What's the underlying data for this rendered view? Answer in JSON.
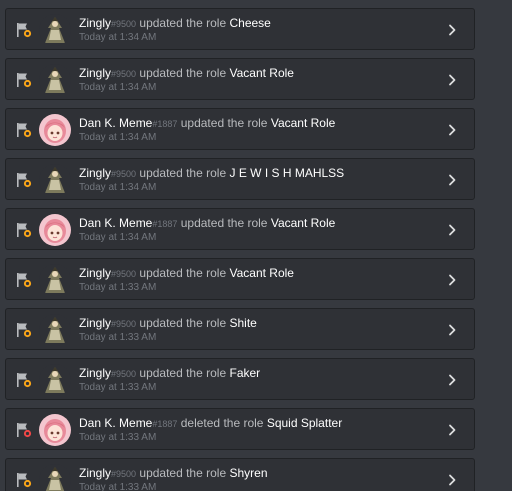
{
  "entries": [
    {
      "user": "Zingly",
      "disc": "#9500",
      "action": "updated the role",
      "target": "Cheese",
      "time": "Today at 1:34 AM",
      "avatar": "zingly",
      "flag": "update"
    },
    {
      "user": "Zingly",
      "disc": "#9500",
      "action": "updated the role",
      "target": "Vacant Role",
      "time": "Today at 1:34 AM",
      "avatar": "zingly",
      "flag": "update"
    },
    {
      "user": "Dan K. Meme",
      "disc": "#1887",
      "action": "updated the role",
      "target": "Vacant Role",
      "time": "Today at 1:34 AM",
      "avatar": "dan",
      "flag": "update"
    },
    {
      "user": "Zingly",
      "disc": "#9500",
      "action": "updated the role",
      "target": "J E W I S H MAHLSS",
      "time": "Today at 1:34 AM",
      "avatar": "zingly",
      "flag": "update"
    },
    {
      "user": "Dan K. Meme",
      "disc": "#1887",
      "action": "updated the role",
      "target": "Vacant Role",
      "time": "Today at 1:34 AM",
      "avatar": "dan",
      "flag": "update"
    },
    {
      "user": "Zingly",
      "disc": "#9500",
      "action": "updated the role",
      "target": "Vacant Role",
      "time": "Today at 1:33 AM",
      "avatar": "zingly",
      "flag": "update"
    },
    {
      "user": "Zingly",
      "disc": "#9500",
      "action": "updated the role",
      "target": "Shite",
      "time": "Today at 1:33 AM",
      "avatar": "zingly",
      "flag": "update"
    },
    {
      "user": "Zingly",
      "disc": "#9500",
      "action": "updated the role",
      "target": "Faker",
      "time": "Today at 1:33 AM",
      "avatar": "zingly",
      "flag": "update"
    },
    {
      "user": "Dan K. Meme",
      "disc": "#1887",
      "action": "deleted the role",
      "target": "Squid Splatter",
      "time": "Today at 1:33 AM",
      "avatar": "dan",
      "flag": "delete"
    },
    {
      "user": "Zingly",
      "disc": "#9500",
      "action": "updated the role",
      "target": "Shyren",
      "time": "Today at 1:33 AM",
      "avatar": "zingly",
      "flag": "update"
    }
  ],
  "colors": {
    "background": "#36393f",
    "entry_background": "#2f3136",
    "update_badge": "#faa61a",
    "delete_badge": "#f04747",
    "username": "#ffffff",
    "meta": "#72767d"
  }
}
